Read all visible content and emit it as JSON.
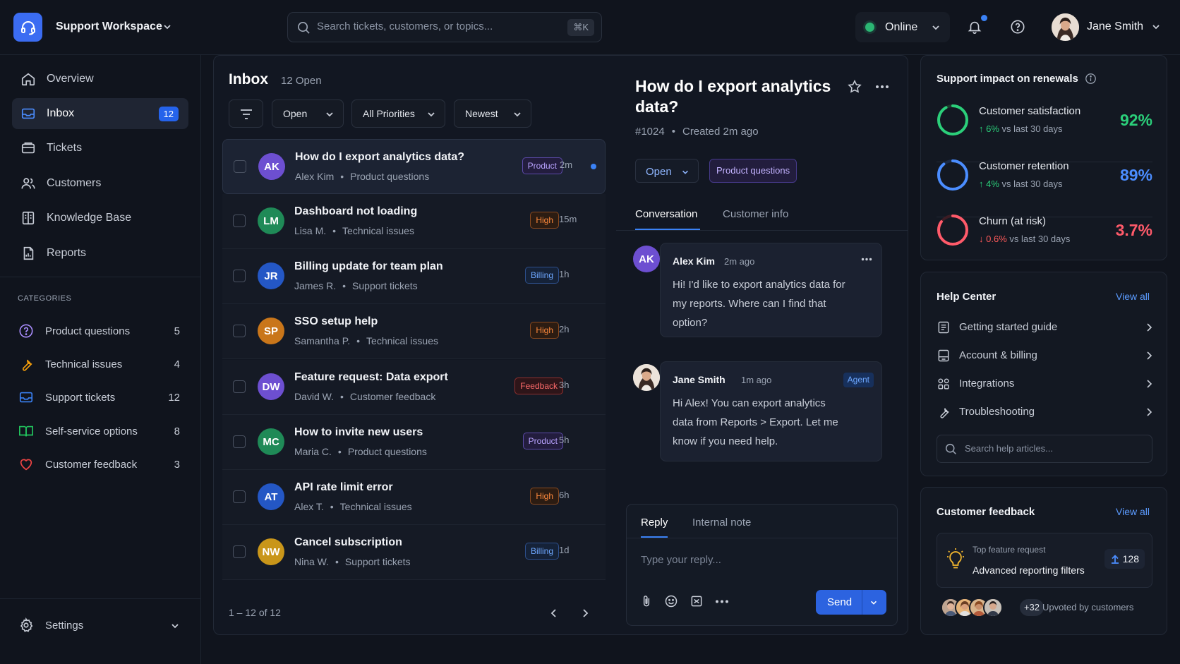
{
  "header": {
    "workspace_name": "Support Workspace",
    "search_placeholder": "Search tickets, customers, or topics...",
    "search_shortcut": "⌘K",
    "status_label": "Online",
    "status_color": "#2bb673",
    "user_name": "Jane Smith",
    "notifications_unread": true
  },
  "sidebar": {
    "nav": [
      {
        "label": "Overview",
        "icon": "home-icon"
      },
      {
        "label": "Inbox",
        "icon": "inbox-icon",
        "badge": "12",
        "active": true
      },
      {
        "label": "Tickets",
        "icon": "ticket-icon"
      },
      {
        "label": "Customers",
        "icon": "users-icon"
      },
      {
        "label": "Knowledge Base",
        "icon": "book-icon"
      },
      {
        "label": "Reports",
        "icon": "report-icon"
      }
    ],
    "categories_title": "CATEGORIES",
    "categories": [
      {
        "label": "Product questions",
        "count": "5",
        "icon": "question-icon",
        "color": "#a78bfa"
      },
      {
        "label": "Technical issues",
        "count": "4",
        "icon": "wrench-icon",
        "color": "#f59e0b"
      },
      {
        "label": "Support tickets",
        "count": "12",
        "icon": "inbox-icon",
        "color": "#3b82f6"
      },
      {
        "label": "Self-service options",
        "count": "8",
        "icon": "book-open-icon",
        "color": "#22c55e"
      },
      {
        "label": "Customer feedback",
        "count": "3",
        "icon": "heart-icon",
        "color": "#ef4444"
      }
    ],
    "settings_label": "Settings"
  },
  "inbox": {
    "title": "Inbox",
    "open_count": "12 Open",
    "filters": {
      "status": "Open",
      "priority": "All Priorities",
      "sort": "Newest"
    },
    "tickets": [
      {
        "initials": "AK",
        "color": "#6d4fd1",
        "title": "How do I export analytics data?",
        "customer": "Alex Kim",
        "category": "Product questions",
        "tag": "Product",
        "tag_type": "product",
        "time": "2m",
        "unread": true,
        "selected": true
      },
      {
        "initials": "LM",
        "color": "#1f8a57",
        "title": "Dashboard not loading",
        "customer": "Lisa M.",
        "category": "Technical issues",
        "tag": "High",
        "tag_type": "high",
        "time": "15m"
      },
      {
        "initials": "JR",
        "color": "#2457c5",
        "title": "Billing update for team plan",
        "customer": "James R.",
        "category": "Support tickets",
        "tag": "Billing",
        "tag_type": "billing",
        "time": "1h"
      },
      {
        "initials": "SP",
        "color": "#c9761a",
        "title": "SSO setup help",
        "customer": "Samantha P.",
        "category": "Technical issues",
        "tag": "High",
        "tag_type": "high",
        "time": "2h"
      },
      {
        "initials": "DW",
        "color": "#6d4fd1",
        "title": "Feature request: Data export",
        "customer": "David W.",
        "category": "Customer feedback",
        "tag": "Feedback",
        "tag_type": "feedback",
        "time": "3h"
      },
      {
        "initials": "MC",
        "color": "#1f8a57",
        "title": "How to invite new users",
        "customer": "Maria C.",
        "category": "Product questions",
        "tag": "Product",
        "tag_type": "product",
        "time": "5h"
      },
      {
        "initials": "AT",
        "color": "#2457c5",
        "title": "API rate limit error",
        "customer": "Alex T.",
        "category": "Technical issues",
        "tag": "High",
        "tag_type": "high",
        "time": "6h"
      },
      {
        "initials": "NW",
        "color": "#c9961a",
        "title": "Cancel subscription",
        "customer": "Nina W.",
        "category": "Support tickets",
        "tag": "Billing",
        "tag_type": "billing",
        "time": "1d"
      }
    ],
    "pagination": "1 – 12 of 12"
  },
  "conversation": {
    "title": "How do I export analytics data?",
    "ticket_id": "#1024",
    "created": "Created 2m ago",
    "status": "Open",
    "category": "Product questions",
    "tabs": [
      "Conversation",
      "Customer info"
    ],
    "messages": [
      {
        "author": "Alex Kim",
        "initials": "AK",
        "time": "2m ago",
        "text": "Hi! I'd like to export analytics data for my reports. Where can I find that option?"
      },
      {
        "author": "Jane Smith",
        "time": "1m ago",
        "badge": "Agent",
        "text": "Hi Alex! You can export analytics data from Reports > Export. Let me know if you need help."
      }
    ],
    "reply_tabs": [
      "Reply",
      "Internal note"
    ],
    "reply_placeholder": "Type your reply...",
    "send_label": "Send"
  },
  "impact": {
    "title": "Support impact on renewals",
    "metrics": [
      {
        "label": "Customer satisfaction",
        "delta": "6%",
        "direction": "up",
        "comparison": "vs last 30 days",
        "value": "92%",
        "fraction": 0.92,
        "color": "#2bcf7a"
      },
      {
        "label": "Customer retention",
        "delta": "4%",
        "direction": "up",
        "comparison": "vs last 30 days",
        "value": "89%",
        "fraction": 0.89,
        "color": "#4b8dff"
      },
      {
        "label": "Churn (at risk)",
        "delta": "0.6%",
        "direction": "down",
        "comparison": "vs last 30 days",
        "value": "3.7%",
        "fraction": 0.85,
        "color": "#ff5a6a"
      }
    ]
  },
  "help_center": {
    "title": "Help Center",
    "view_all": "View all",
    "items": [
      {
        "label": "Getting started guide",
        "icon": "doc-icon"
      },
      {
        "label": "Account & billing",
        "icon": "card-icon"
      },
      {
        "label": "Integrations",
        "icon": "grid-icon"
      },
      {
        "label": "Troubleshooting",
        "icon": "wrench-icon"
      }
    ],
    "search_placeholder": "Search help articles..."
  },
  "feedback": {
    "title": "Customer feedback",
    "view_all": "View all",
    "kicker": "Top feature request",
    "request": "Advanced reporting filters",
    "votes": "128",
    "more_count": "+32",
    "caption": "Upvoted by customers"
  }
}
